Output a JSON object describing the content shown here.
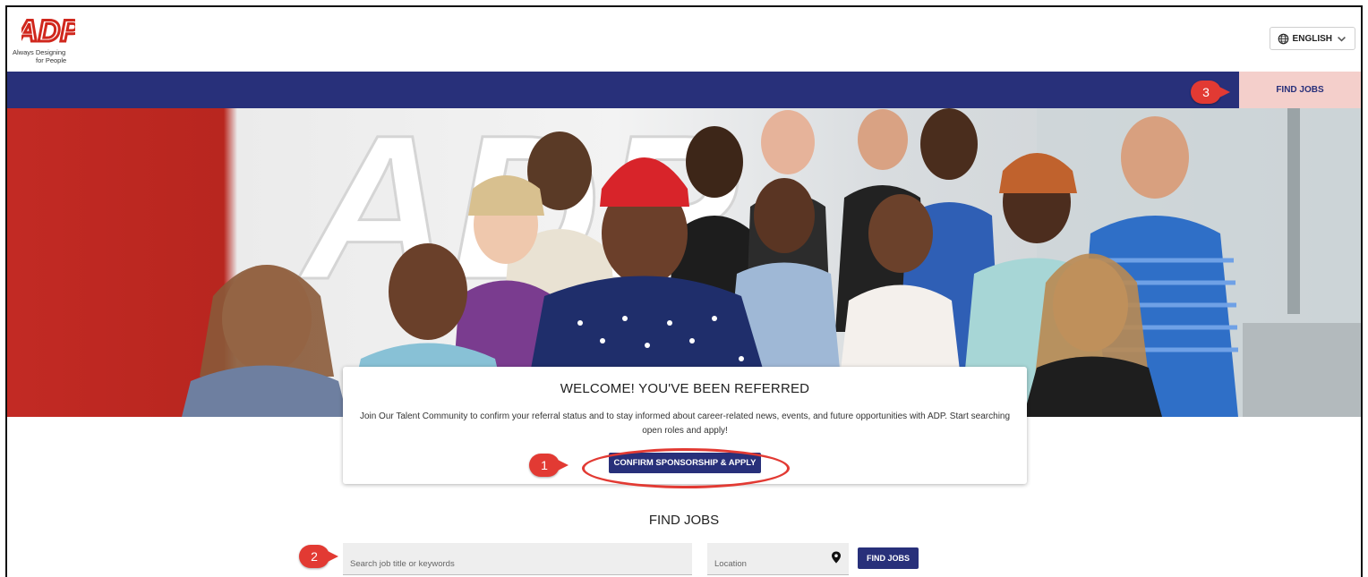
{
  "brand": {
    "logo_text": "ADP",
    "tagline_line1": "Always Designing",
    "tagline_line2": "for People",
    "accent": "#d0271d",
    "navy": "#28307a",
    "highlight": "#f4cfcb"
  },
  "header": {
    "language_label": "ENGLISH",
    "language_icon": "globe-icon",
    "language_caret": "chevron-down-icon"
  },
  "nav": {
    "find_jobs_label": "FIND JOBS"
  },
  "hero": {
    "image": "group-photo-of-smiling-employees"
  },
  "welcome": {
    "title": "WELCOME! YOU'VE BEEN REFERRED",
    "body": "Join Our Talent Community to confirm your referral status and to stay informed about career-related news, events, and future opportunities with ADP. Start searching open roles and apply!",
    "button_label": "CONFIRM SPONSORSHIP & APPLY"
  },
  "find_jobs": {
    "title": "FIND JOBS",
    "search_placeholder": "Search job title or keywords",
    "location_placeholder": "Location",
    "location_icon": "map-pin-icon",
    "button_label": "FIND JOBS"
  },
  "annotations": {
    "step1": "1",
    "step2": "2",
    "step3": "3",
    "color": "#e23a33"
  }
}
